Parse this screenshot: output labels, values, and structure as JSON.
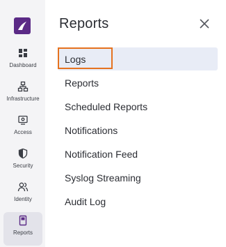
{
  "sidebar": {
    "items": [
      {
        "label": "Dashboard",
        "icon": "dashboard-icon"
      },
      {
        "label": "Infrastructure",
        "icon": "infrastructure-icon"
      },
      {
        "label": "Access",
        "icon": "access-icon"
      },
      {
        "label": "Security",
        "icon": "security-icon"
      },
      {
        "label": "Identity",
        "icon": "identity-icon"
      },
      {
        "label": "Reports",
        "icon": "reports-icon",
        "active": true
      }
    ]
  },
  "panel": {
    "title": "Reports",
    "items": [
      {
        "label": "Logs",
        "selected": true
      },
      {
        "label": "Reports"
      },
      {
        "label": "Scheduled Reports"
      },
      {
        "label": "Notifications"
      },
      {
        "label": "Notification Feed"
      },
      {
        "label": "Syslog Streaming"
      },
      {
        "label": "Audit Log"
      }
    ]
  },
  "colors": {
    "brand": "#5b2a86",
    "highlight": "#e5721f",
    "selected_bg": "#e8ecf6",
    "rail_bg": "#f4f4f6"
  }
}
